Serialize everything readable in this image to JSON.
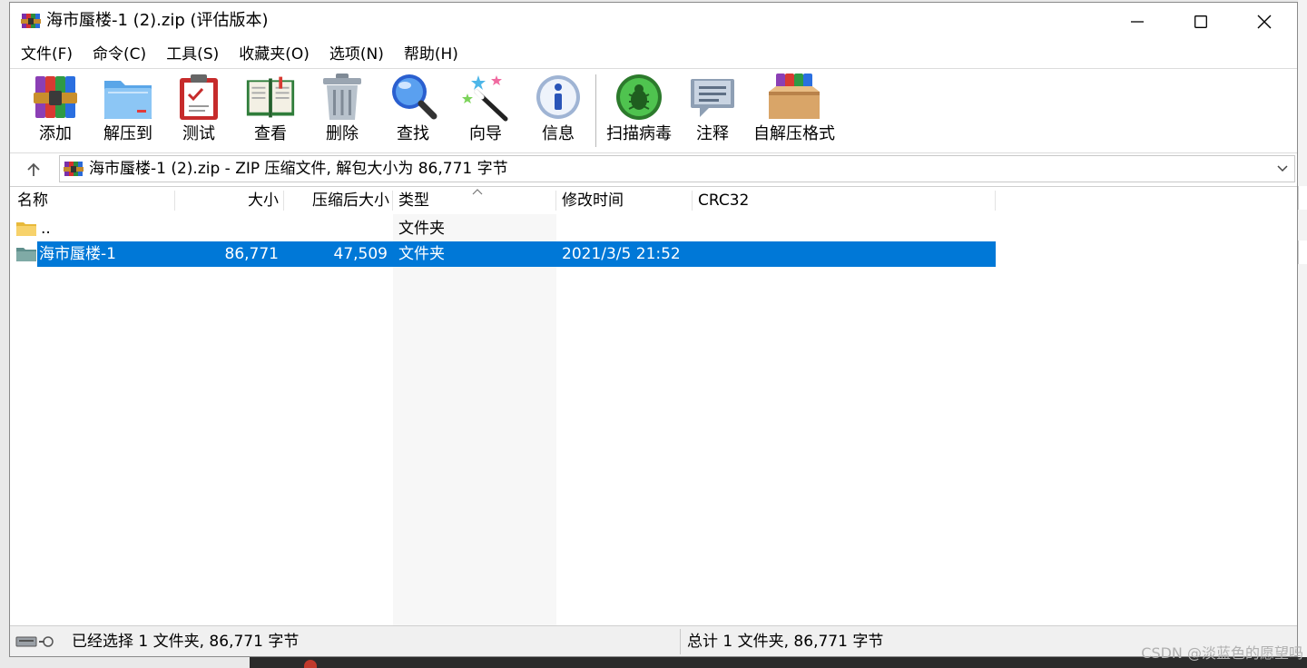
{
  "window": {
    "title": "海市蜃楼-1 (2).zip (评估版本)",
    "minimize_icon": "minimize-icon",
    "maximize_icon": "maximize-icon",
    "close_icon": "close-icon"
  },
  "menu": [
    {
      "label": "文件(F)"
    },
    {
      "label": "命令(C)"
    },
    {
      "label": "工具(S)"
    },
    {
      "label": "收藏夹(O)"
    },
    {
      "label": "选项(N)"
    },
    {
      "label": "帮助(H)"
    }
  ],
  "toolbar": {
    "add": "添加",
    "extract": "解压到",
    "test": "测试",
    "view": "查看",
    "delete": "删除",
    "find": "查找",
    "wizard": "向导",
    "info": "信息",
    "virus_scan": "扫描病毒",
    "comment": "注释",
    "sfx": "自解压格式"
  },
  "address": {
    "text": "海市蜃楼-1 (2).zip - ZIP 压缩文件, 解包大小为 86,771 字节"
  },
  "columns": {
    "name": "名称",
    "size": "大小",
    "packed": "压缩后大小",
    "type": "类型",
    "modified": "修改时间",
    "crc": "CRC32"
  },
  "rows": [
    {
      "name": "..",
      "size": "",
      "packed": "",
      "type": "文件夹",
      "modified": "",
      "crc": ""
    },
    {
      "name": "海市蜃楼-1",
      "size": "86,771",
      "packed": "47,509",
      "type": "文件夹",
      "modified": "2021/3/5 21:52",
      "crc": ""
    }
  ],
  "status": {
    "left": "已经选择 1 文件夹, 86,771 字节",
    "right": "总计 1 文件夹, 86,771 字节"
  },
  "watermark": "CSDN @淡蓝色的愿望吗",
  "colors": {
    "selection": "#0078d7",
    "window_bg": "#ffffff",
    "status_bg": "#f0f0f0"
  }
}
